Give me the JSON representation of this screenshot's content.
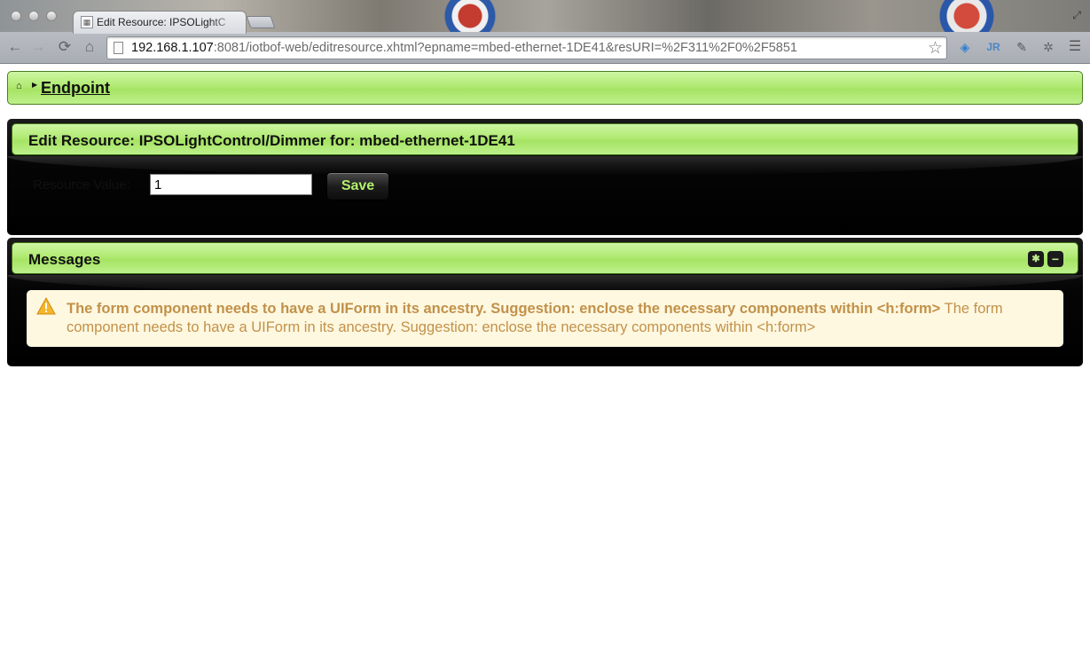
{
  "browser": {
    "tab_title": "Edit Resource: IPSOLightC",
    "url_host": "192.168.1.107",
    "url_rest": ":8081/iotbof-web/editresource.xhtml?epname=mbed-ethernet-1DE41&resURI=%2F311%2F0%2F5851"
  },
  "breadcrumb": {
    "link": "Endpoint"
  },
  "edit_panel": {
    "title": "Edit Resource: IPSOLightControl/Dimmer for: mbed-ethernet-1DE41",
    "field_label": "Resource Value:",
    "field_value": "1",
    "save_label": "Save"
  },
  "messages_panel": {
    "title": "Messages",
    "summary": "The form component needs to have a UIForm in its ancestry. Suggestion: enclose the necessary components within <h:form>",
    "detail": "The form component needs to have a UIForm in its ancestry. Suggestion: enclose the necessary components within <h:form>"
  },
  "colors": {
    "header_green": "#b1ea73",
    "save_text": "#b3ef6e",
    "message_bg": "#fef8e1",
    "message_text": "#c29149"
  }
}
